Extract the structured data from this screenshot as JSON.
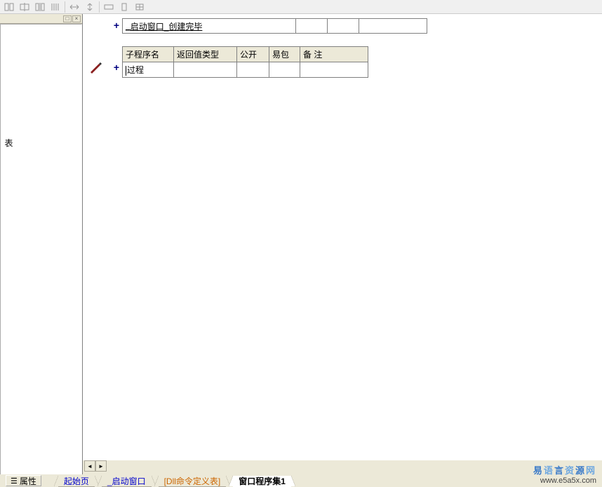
{
  "toolbar": {
    "buttons": [
      "align-left",
      "align-center",
      "align-distribute",
      "align-stretch",
      "h-space",
      "v-space",
      "fit-width",
      "fit-height",
      "fit-both"
    ]
  },
  "left_panel": {
    "controls": {
      "minimize": "□",
      "close": "×"
    },
    "side_label": "表"
  },
  "editor": {
    "row1": {
      "name_prefix": "_",
      "name": "启动窗口_创建完毕"
    },
    "sub_table": {
      "headers": {
        "name": "子程序名",
        "rettype": "返回值类型",
        "pub": "公开",
        "yibao": "易包",
        "note": "备 注"
      },
      "row": {
        "prefix": "",
        "name": "过程"
      }
    }
  },
  "bottom": {
    "prop_button": "属性",
    "tabs": [
      {
        "label": "起始页",
        "style": "blue",
        "active": false
      },
      {
        "label": "_启动窗口",
        "style": "blue",
        "active": false
      },
      {
        "label": "[Dll命令定义表]",
        "style": "orange",
        "active": false
      },
      {
        "label": "窗口程序集1",
        "style": "default",
        "active": true
      }
    ]
  },
  "watermark": {
    "line1": "易语言资源网",
    "line2": "www.e5a5x.com"
  }
}
